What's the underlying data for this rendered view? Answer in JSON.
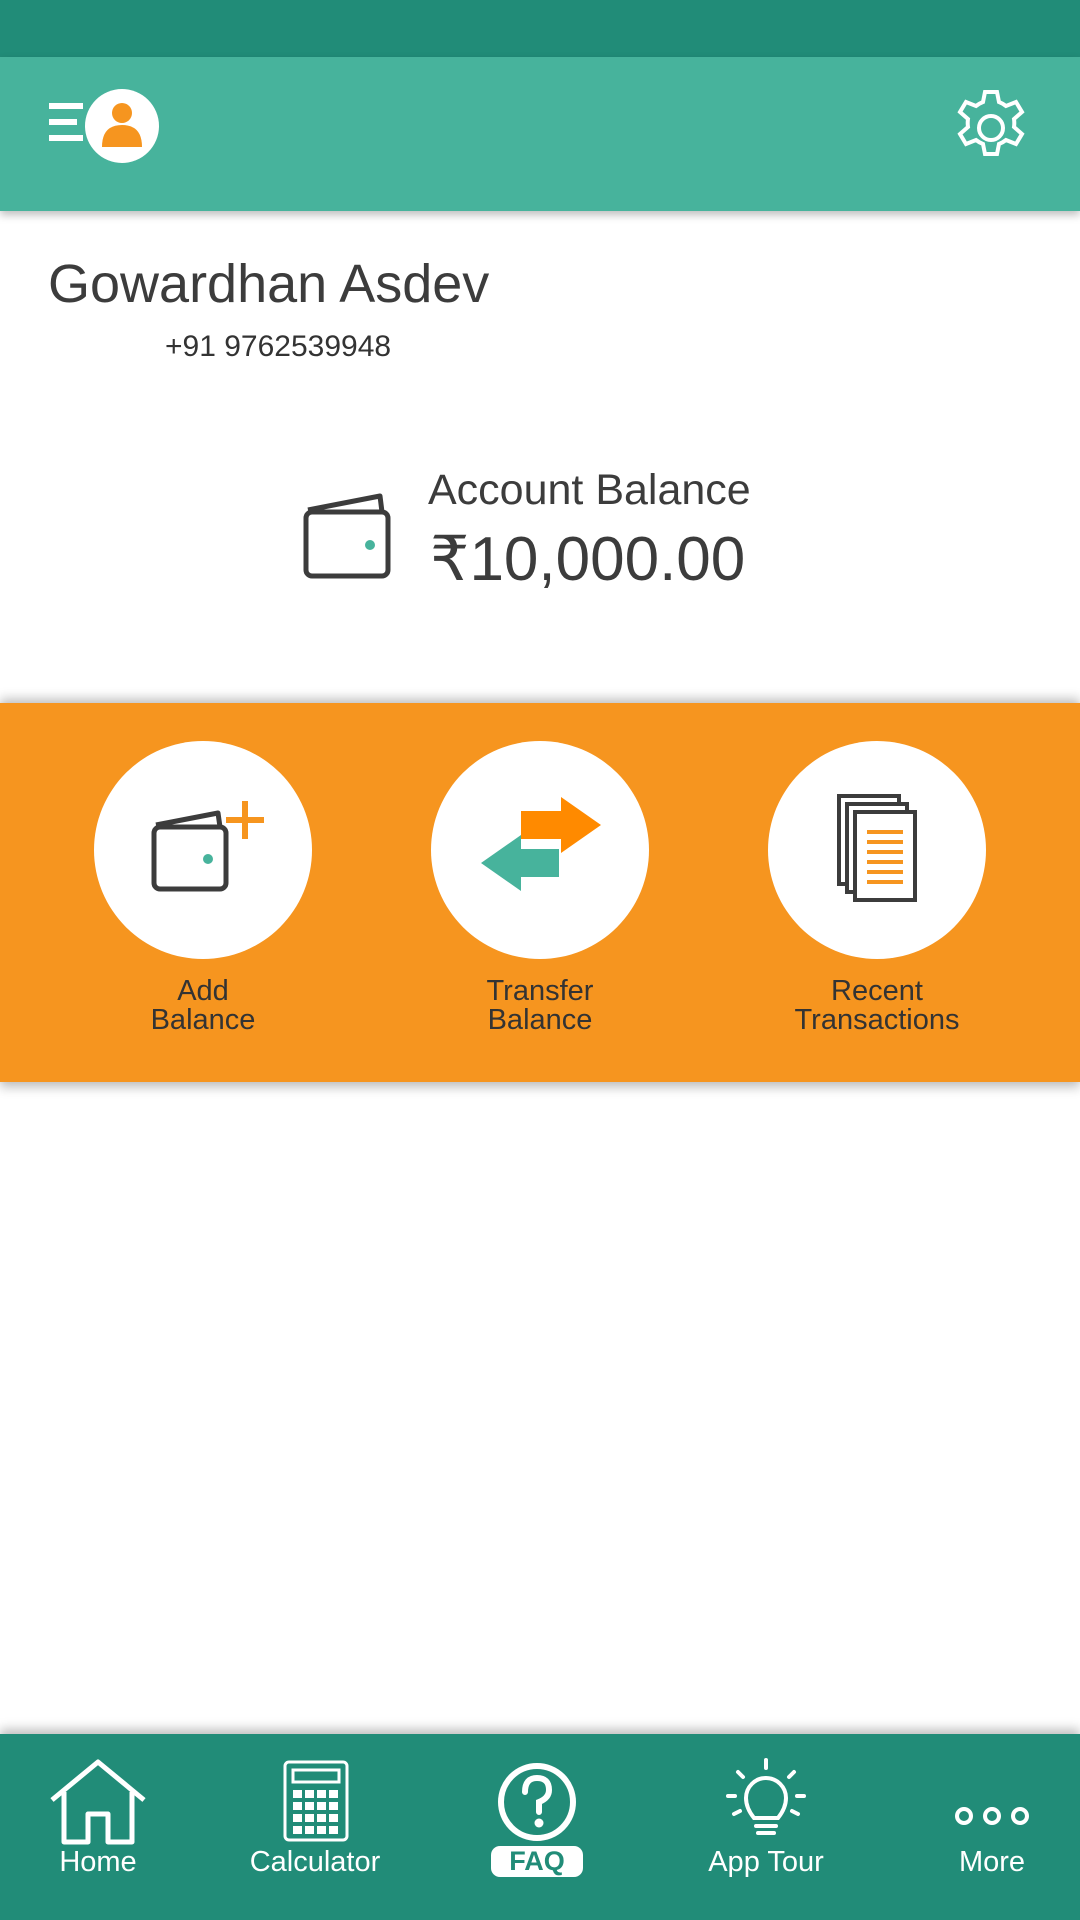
{
  "user": {
    "name": "Gowardhan Asdev",
    "phone": "+91 9762539948"
  },
  "balance": {
    "label": "Account Balance",
    "amount": "₹10,000.00"
  },
  "actions": [
    {
      "line1": "Add",
      "line2": "Balance",
      "icon": "wallet-plus-icon"
    },
    {
      "line1": "Transfer",
      "line2": "Balance",
      "icon": "transfer-arrows-icon"
    },
    {
      "line1": "Recent",
      "line2": "Transactions",
      "icon": "documents-icon"
    }
  ],
  "nav": [
    {
      "label": "Home",
      "icon": "home-icon"
    },
    {
      "label": "Calculator",
      "icon": "calculator-icon"
    },
    {
      "label": "FAQ",
      "icon": "question-icon",
      "active": true
    },
    {
      "label": "App Tour",
      "icon": "lightbulb-icon"
    },
    {
      "label": "More",
      "icon": "more-dots-icon"
    }
  ],
  "colors": {
    "status_bar": "#218c78",
    "app_bar": "#47b39c",
    "accent_orange": "#f6951f",
    "bottom_nav": "#218c78",
    "teal_icon": "#47b39c",
    "dark_text": "#3c3c3c"
  }
}
